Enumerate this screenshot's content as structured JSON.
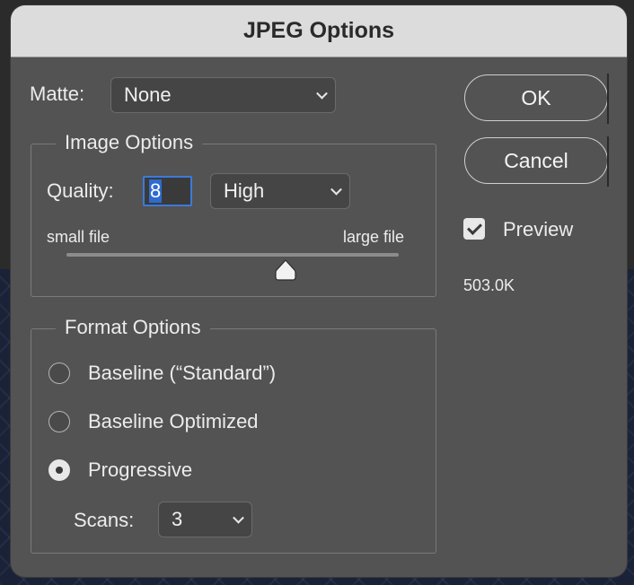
{
  "dialog": {
    "title": "JPEG Options"
  },
  "matte": {
    "label": "Matte:",
    "value": "None"
  },
  "image_options": {
    "legend": "Image Options",
    "quality_label": "Quality:",
    "quality_value": "8",
    "quality_preset": "High",
    "slider_min_label": "small file",
    "slider_max_label": "large file",
    "slider_level": 0.66
  },
  "format_options": {
    "legend": "Format Options",
    "options": [
      {
        "label": "Baseline (“Standard”)",
        "selected": false
      },
      {
        "label": "Baseline Optimized",
        "selected": false
      },
      {
        "label": "Progressive",
        "selected": true
      }
    ],
    "scans_label": "Scans:",
    "scans_value": "3"
  },
  "buttons": {
    "ok": "OK",
    "cancel": "Cancel"
  },
  "preview": {
    "label": "Preview",
    "checked": true,
    "file_size": "503.0K"
  },
  "colors": {
    "dialog_bg": "#535353",
    "focus_blue": "#2e6bd0",
    "titlebar": "#dcdcdc"
  }
}
